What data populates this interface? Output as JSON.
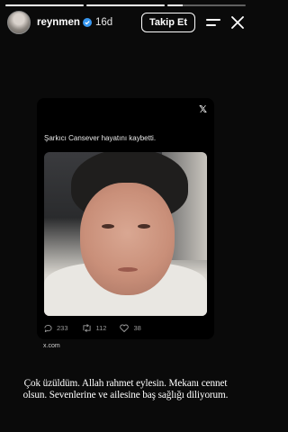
{
  "story": {
    "progress_fractions": [
      1,
      1,
      0.2
    ]
  },
  "header": {
    "username": "reynmen",
    "time": "16d",
    "follow_label": "Takip Et"
  },
  "tweet": {
    "text": "Şarkıcı Cansever hayatını kaybetti.",
    "replies": "233",
    "retweets": "112",
    "likes": "38",
    "source": "x.com"
  },
  "caption": "Çok üzüldüm. Allah rahmet eylesin. Mekanı cennet olsun. Sevenlerine ve ailesine baş sağlığı diliyorum.",
  "colors": {
    "background": "#0a0a0a",
    "card": "#000000",
    "verified": "#3897f0"
  },
  "icons": [
    "verified-badge-icon",
    "menu-icon",
    "close-icon",
    "x-logo-icon",
    "reply-icon",
    "retweet-icon",
    "like-icon"
  ]
}
